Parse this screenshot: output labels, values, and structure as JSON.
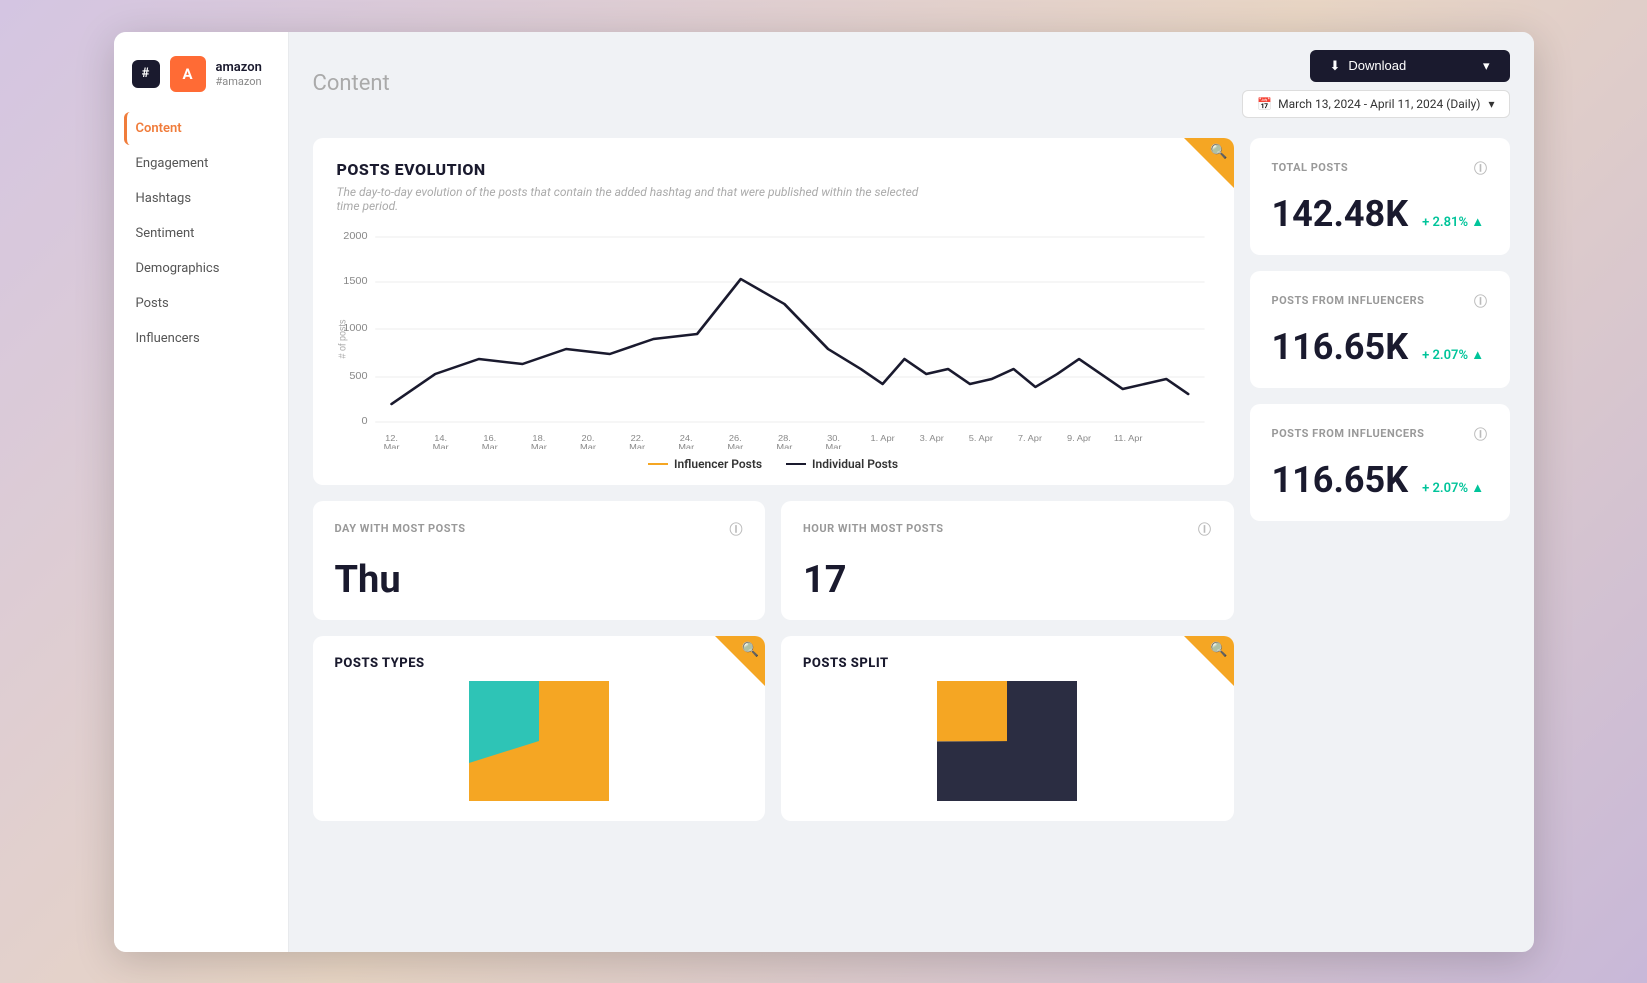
{
  "app": {
    "hash_symbol": "#",
    "account_initial": "A",
    "account_name": "amazon",
    "account_handle": "#amazon"
  },
  "header": {
    "page_title": "Content",
    "download_label": "Download",
    "download_icon": "⬇",
    "date_range": "March 13, 2024 - April 11, 2024 (Daily)",
    "calendar_icon": "📅",
    "dropdown_arrow": "▾"
  },
  "sidebar": {
    "items": [
      {
        "id": "content",
        "label": "Content",
        "active": true
      },
      {
        "id": "engagement",
        "label": "Engagement",
        "active": false
      },
      {
        "id": "hashtags",
        "label": "Hashtags",
        "active": false
      },
      {
        "id": "sentiment",
        "label": "Sentiment",
        "active": false
      },
      {
        "id": "demographics",
        "label": "Demographics",
        "active": false
      },
      {
        "id": "posts",
        "label": "Posts",
        "active": false
      },
      {
        "id": "influencers",
        "label": "Influencers",
        "active": false
      }
    ]
  },
  "posts_evolution": {
    "title": "POSTS EVOLUTION",
    "subtitle": "The day-to-day evolution of the posts that contain the added hashtag and that were published within the selected time period.",
    "y_labels": [
      "2000",
      "1500",
      "1000",
      "500",
      "0"
    ],
    "x_labels": [
      "12. Mar",
      "14. Mar",
      "16. Mar",
      "18. Mar",
      "20. Mar",
      "22. Mar",
      "24. Mar",
      "26. Mar",
      "28. Mar",
      "30. Mar",
      "1. Apr",
      "3. Apr",
      "5. Apr",
      "7. Apr",
      "9. Apr",
      "11. Apr"
    ],
    "y_axis_label": "# of posts",
    "legend_influencer": "Influencer Posts",
    "legend_individual": "Individual Posts",
    "search_icon": "🔍"
  },
  "stats": {
    "total_posts": {
      "label": "TOTAL POSTS",
      "value": "142.48K",
      "change": "+ 2.81%",
      "change_arrow": "▲"
    },
    "posts_from_influencers_top": {
      "label": "POSTS FROM INFLUENCERS",
      "value": "116.65K",
      "change": "+ 2.07%",
      "change_arrow": "▲"
    },
    "posts_from_influencers_bottom": {
      "label": "POSTS FROM INFLUENCERS",
      "value": "116.65K",
      "change": "+ 2.07%",
      "change_arrow": "▲"
    }
  },
  "day_with_most_posts": {
    "label": "DAY WITH MOST POSTS",
    "value": "Thu"
  },
  "hour_with_most_posts": {
    "label": "HOUR WITH MOST POSTS",
    "value": "17"
  },
  "posts_types": {
    "title": "POSTS TYPES",
    "search_icon": "🔍"
  },
  "posts_split": {
    "title": "POSTS SPLIT",
    "search_icon": "🔍"
  },
  "colors": {
    "accent_orange": "#f5a623",
    "accent_teal": "#00c49a",
    "dark": "#1a1a2e",
    "chart_teal": "#2ec4b6",
    "chart_dark": "#2b2d42",
    "chart_orange": "#f5a623"
  }
}
